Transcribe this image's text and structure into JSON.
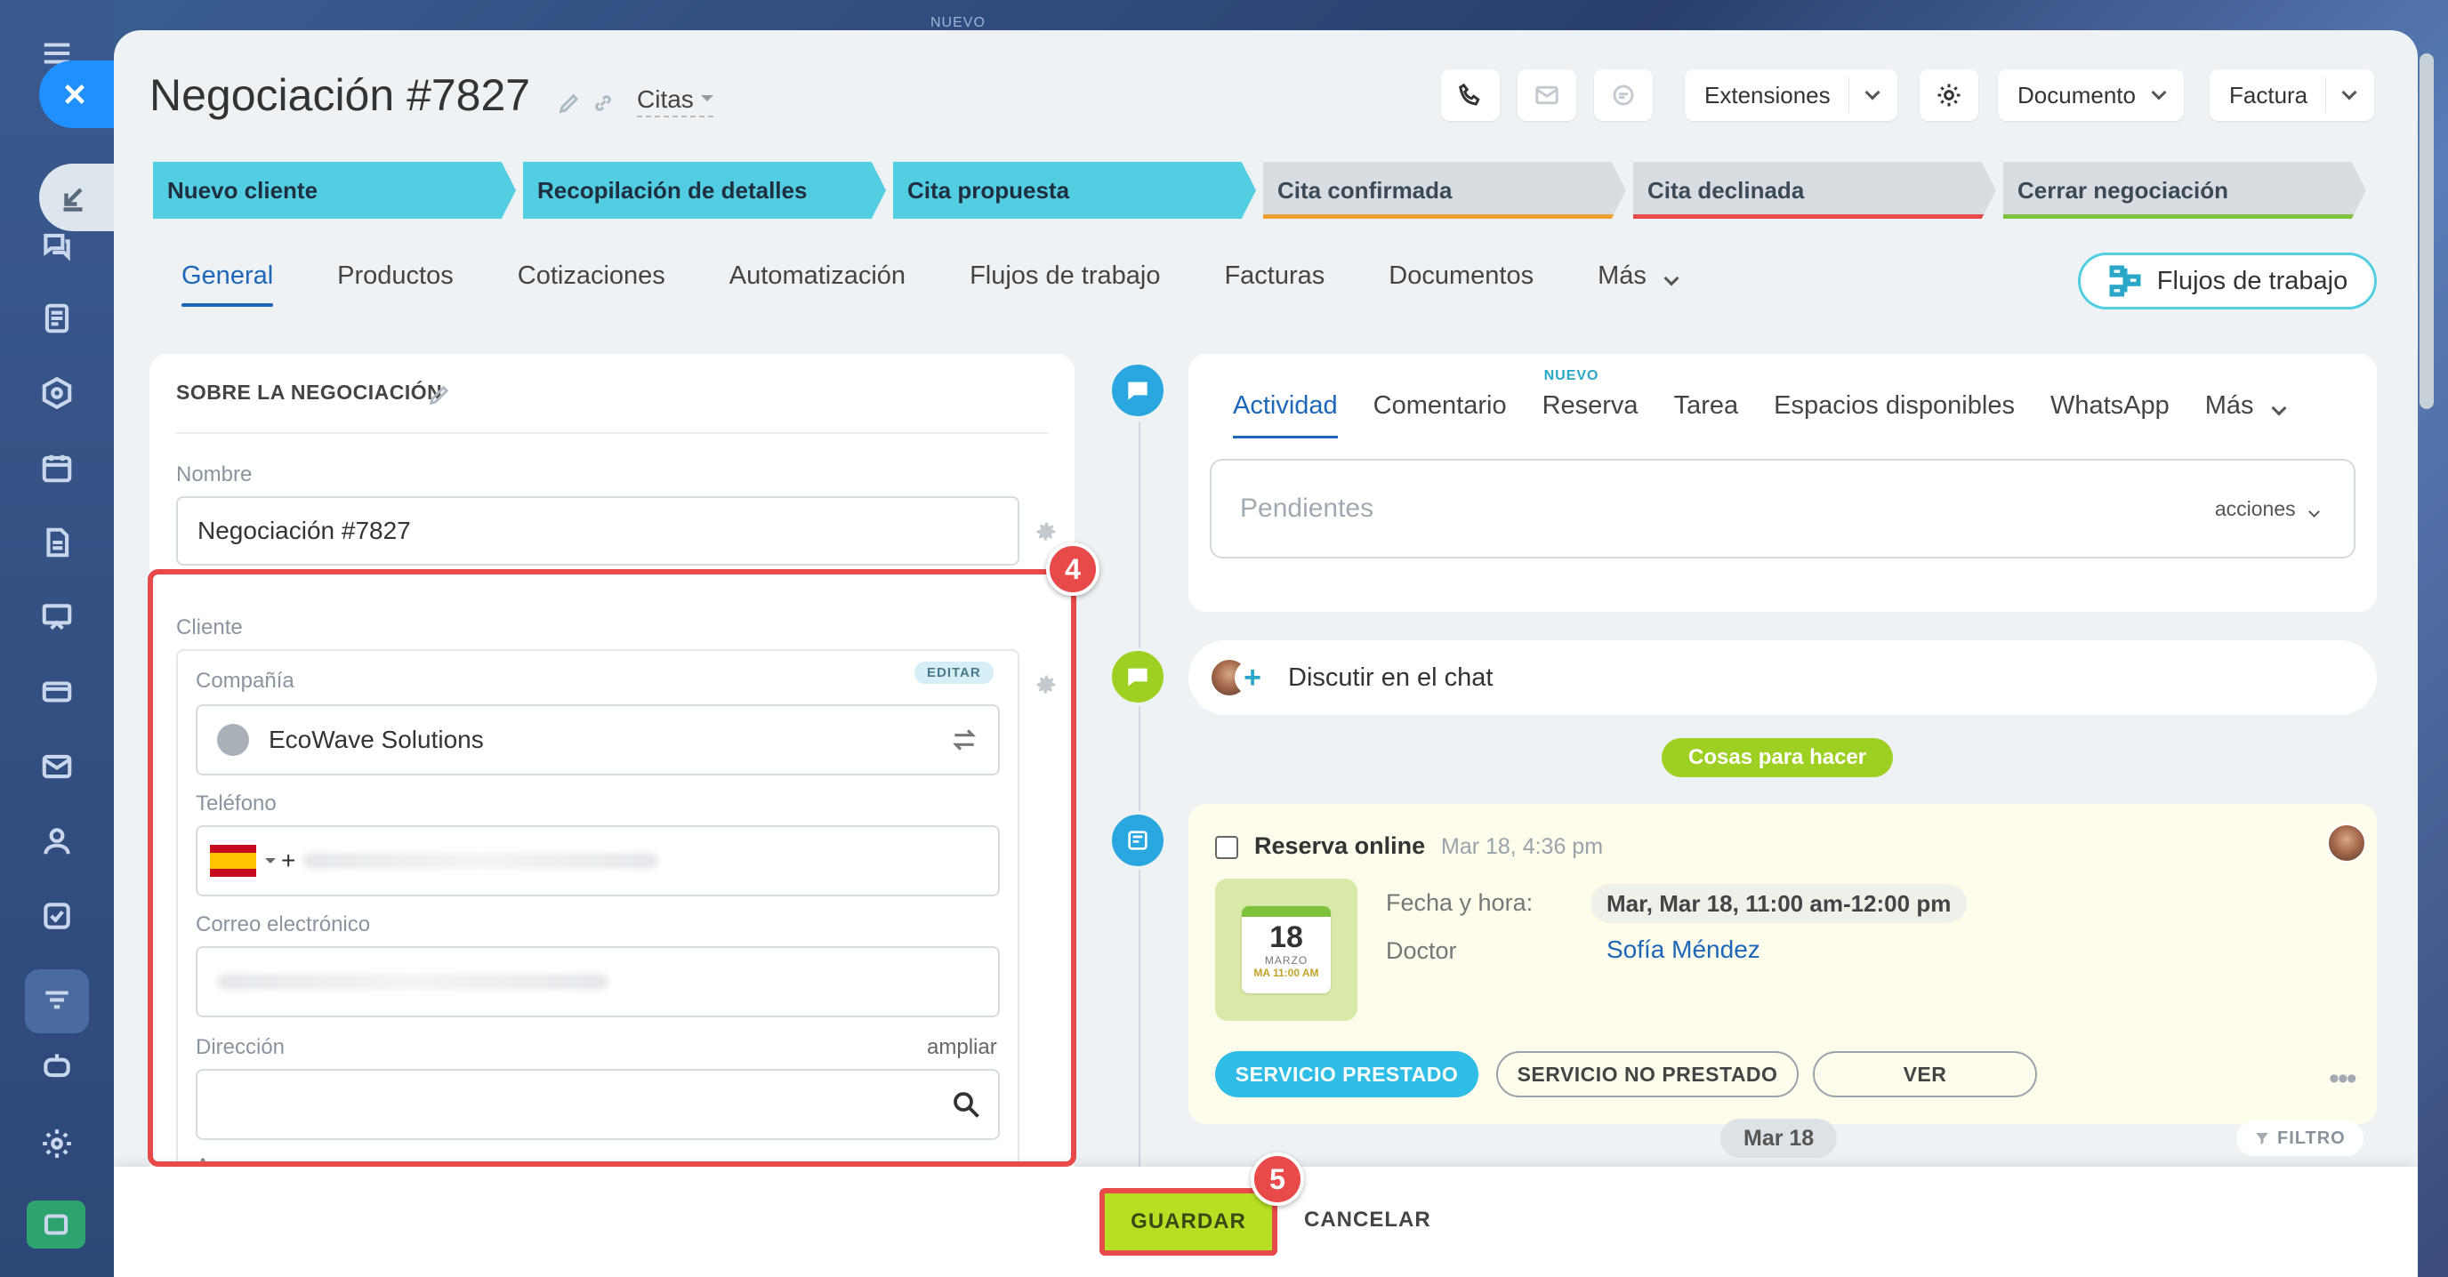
{
  "top_note": "NUEVO",
  "header": {
    "title": "Negociación #7827",
    "pipeline": "Citas",
    "extensions_label": "Extensiones",
    "document_label": "Documento",
    "invoice_label": "Factura"
  },
  "stages": [
    {
      "label": "Nuevo cliente",
      "state": "active",
      "underline": "#53cde2"
    },
    {
      "label": "Recopilación de detalles",
      "state": "active",
      "underline": "#53cde2"
    },
    {
      "label": "Cita propuesta",
      "state": "active",
      "underline": "#53cde2"
    },
    {
      "label": "Cita confirmada",
      "state": "inactive",
      "underline": "#f0a030"
    },
    {
      "label": "Cita declinada",
      "state": "inactive",
      "underline": "#e84a4a"
    },
    {
      "label": "Cerrar negociación",
      "state": "inactive",
      "underline": "#7ec13b"
    }
  ],
  "tabs": [
    "General",
    "Productos",
    "Cotizaciones",
    "Automatización",
    "Flujos de trabajo",
    "Facturas",
    "Documentos",
    "Más"
  ],
  "workflows_button": "Flujos de trabajo",
  "deal_section": {
    "title": "SOBRE LA NEGOCIACIÓN",
    "name_label": "Nombre",
    "name_value": "Negociación #7827",
    "client_label": "Cliente",
    "company_label": "Compañía",
    "company_value": "EcoWave Solutions",
    "edit_badge": "EDITAR",
    "phone_label": "Teléfono",
    "phone_prefix": "+",
    "email_label": "Correo electrónico",
    "address_label": "Dirección",
    "expand_label": "ampliar",
    "add_label": "Agregar"
  },
  "annotations": {
    "box_number": "4",
    "save_number": "5"
  },
  "activity": {
    "tabs": [
      "Actividad",
      "Comentario",
      "Reserva",
      "Tarea",
      "Espacios disponibles",
      "WhatsApp",
      "Más"
    ],
    "new_tag": "NUEVO",
    "pending_placeholder": "Pendientes",
    "actions_label": "acciones",
    "chat_label": "Discutir en el chat",
    "todo_tag": "Cosas para hacer"
  },
  "booking": {
    "title": "Reserva online",
    "date": "Mar 18, 4:36 pm",
    "calendar_day": "18",
    "calendar_month": "MARZO",
    "calendar_time": "MA 11:00 AM",
    "datetime_label": "Fecha y hora:",
    "datetime_value": "Mar, Mar 18, 11:00 am-12:00 pm",
    "doctor_label": "Doctor",
    "doctor_value": "Sofía Méndez",
    "btn_done": "SERVICIO PRESTADO",
    "btn_not_done": "SERVICIO NO PRESTADO",
    "btn_view": "VER"
  },
  "timeline_date": "Mar 18",
  "filter_label": "FILTRO",
  "footer": {
    "save": "GUARDAR",
    "cancel": "CANCELAR"
  }
}
